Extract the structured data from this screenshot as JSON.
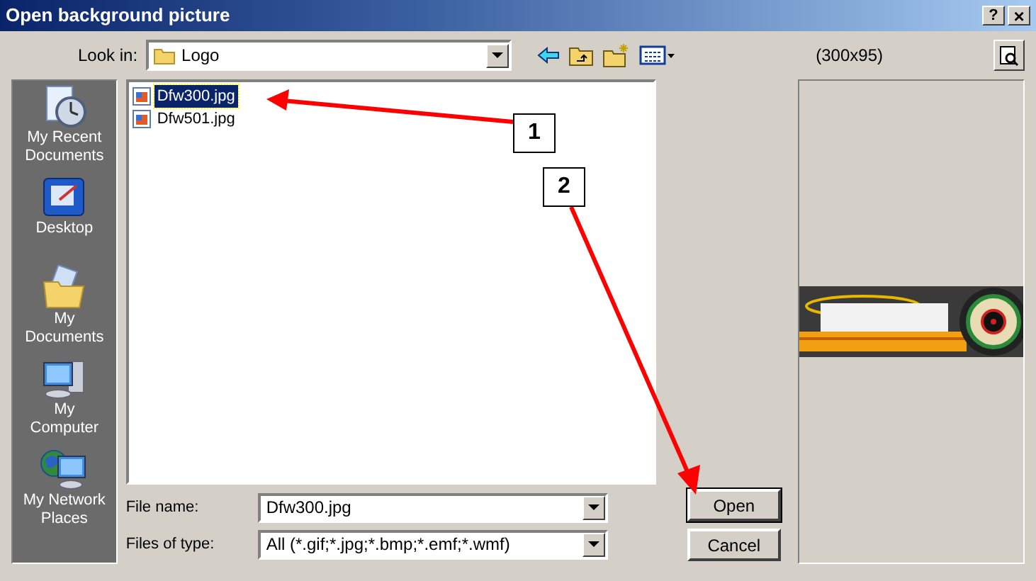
{
  "window": {
    "title": "Open background picture",
    "help": "?",
    "close": "×"
  },
  "toolbar": {
    "look_in_label": "Look in:",
    "look_in_value": "Logo",
    "preview_size": "(300x95)"
  },
  "places": [
    {
      "label": "My Recent Documents",
      "kind": "recent"
    },
    {
      "label": "Desktop",
      "kind": "desktop"
    },
    {
      "label": "My Documents",
      "kind": "documents"
    },
    {
      "label": "My Computer",
      "kind": "computer"
    },
    {
      "label": "My Network Places",
      "kind": "network"
    }
  ],
  "files": [
    {
      "name": "Dfw300.jpg",
      "selected": true
    },
    {
      "name": "Dfw501.jpg",
      "selected": false
    }
  ],
  "file_name": {
    "label": "File name:",
    "value": "Dfw300.jpg"
  },
  "file_type": {
    "label": "Files of type:",
    "value": "All (*.gif;*.jpg;*.bmp;*.emf;*.wmf)"
  },
  "buttons": {
    "open": "Open",
    "cancel": "Cancel"
  },
  "callouts": [
    {
      "number": "1"
    },
    {
      "number": "2"
    }
  ]
}
